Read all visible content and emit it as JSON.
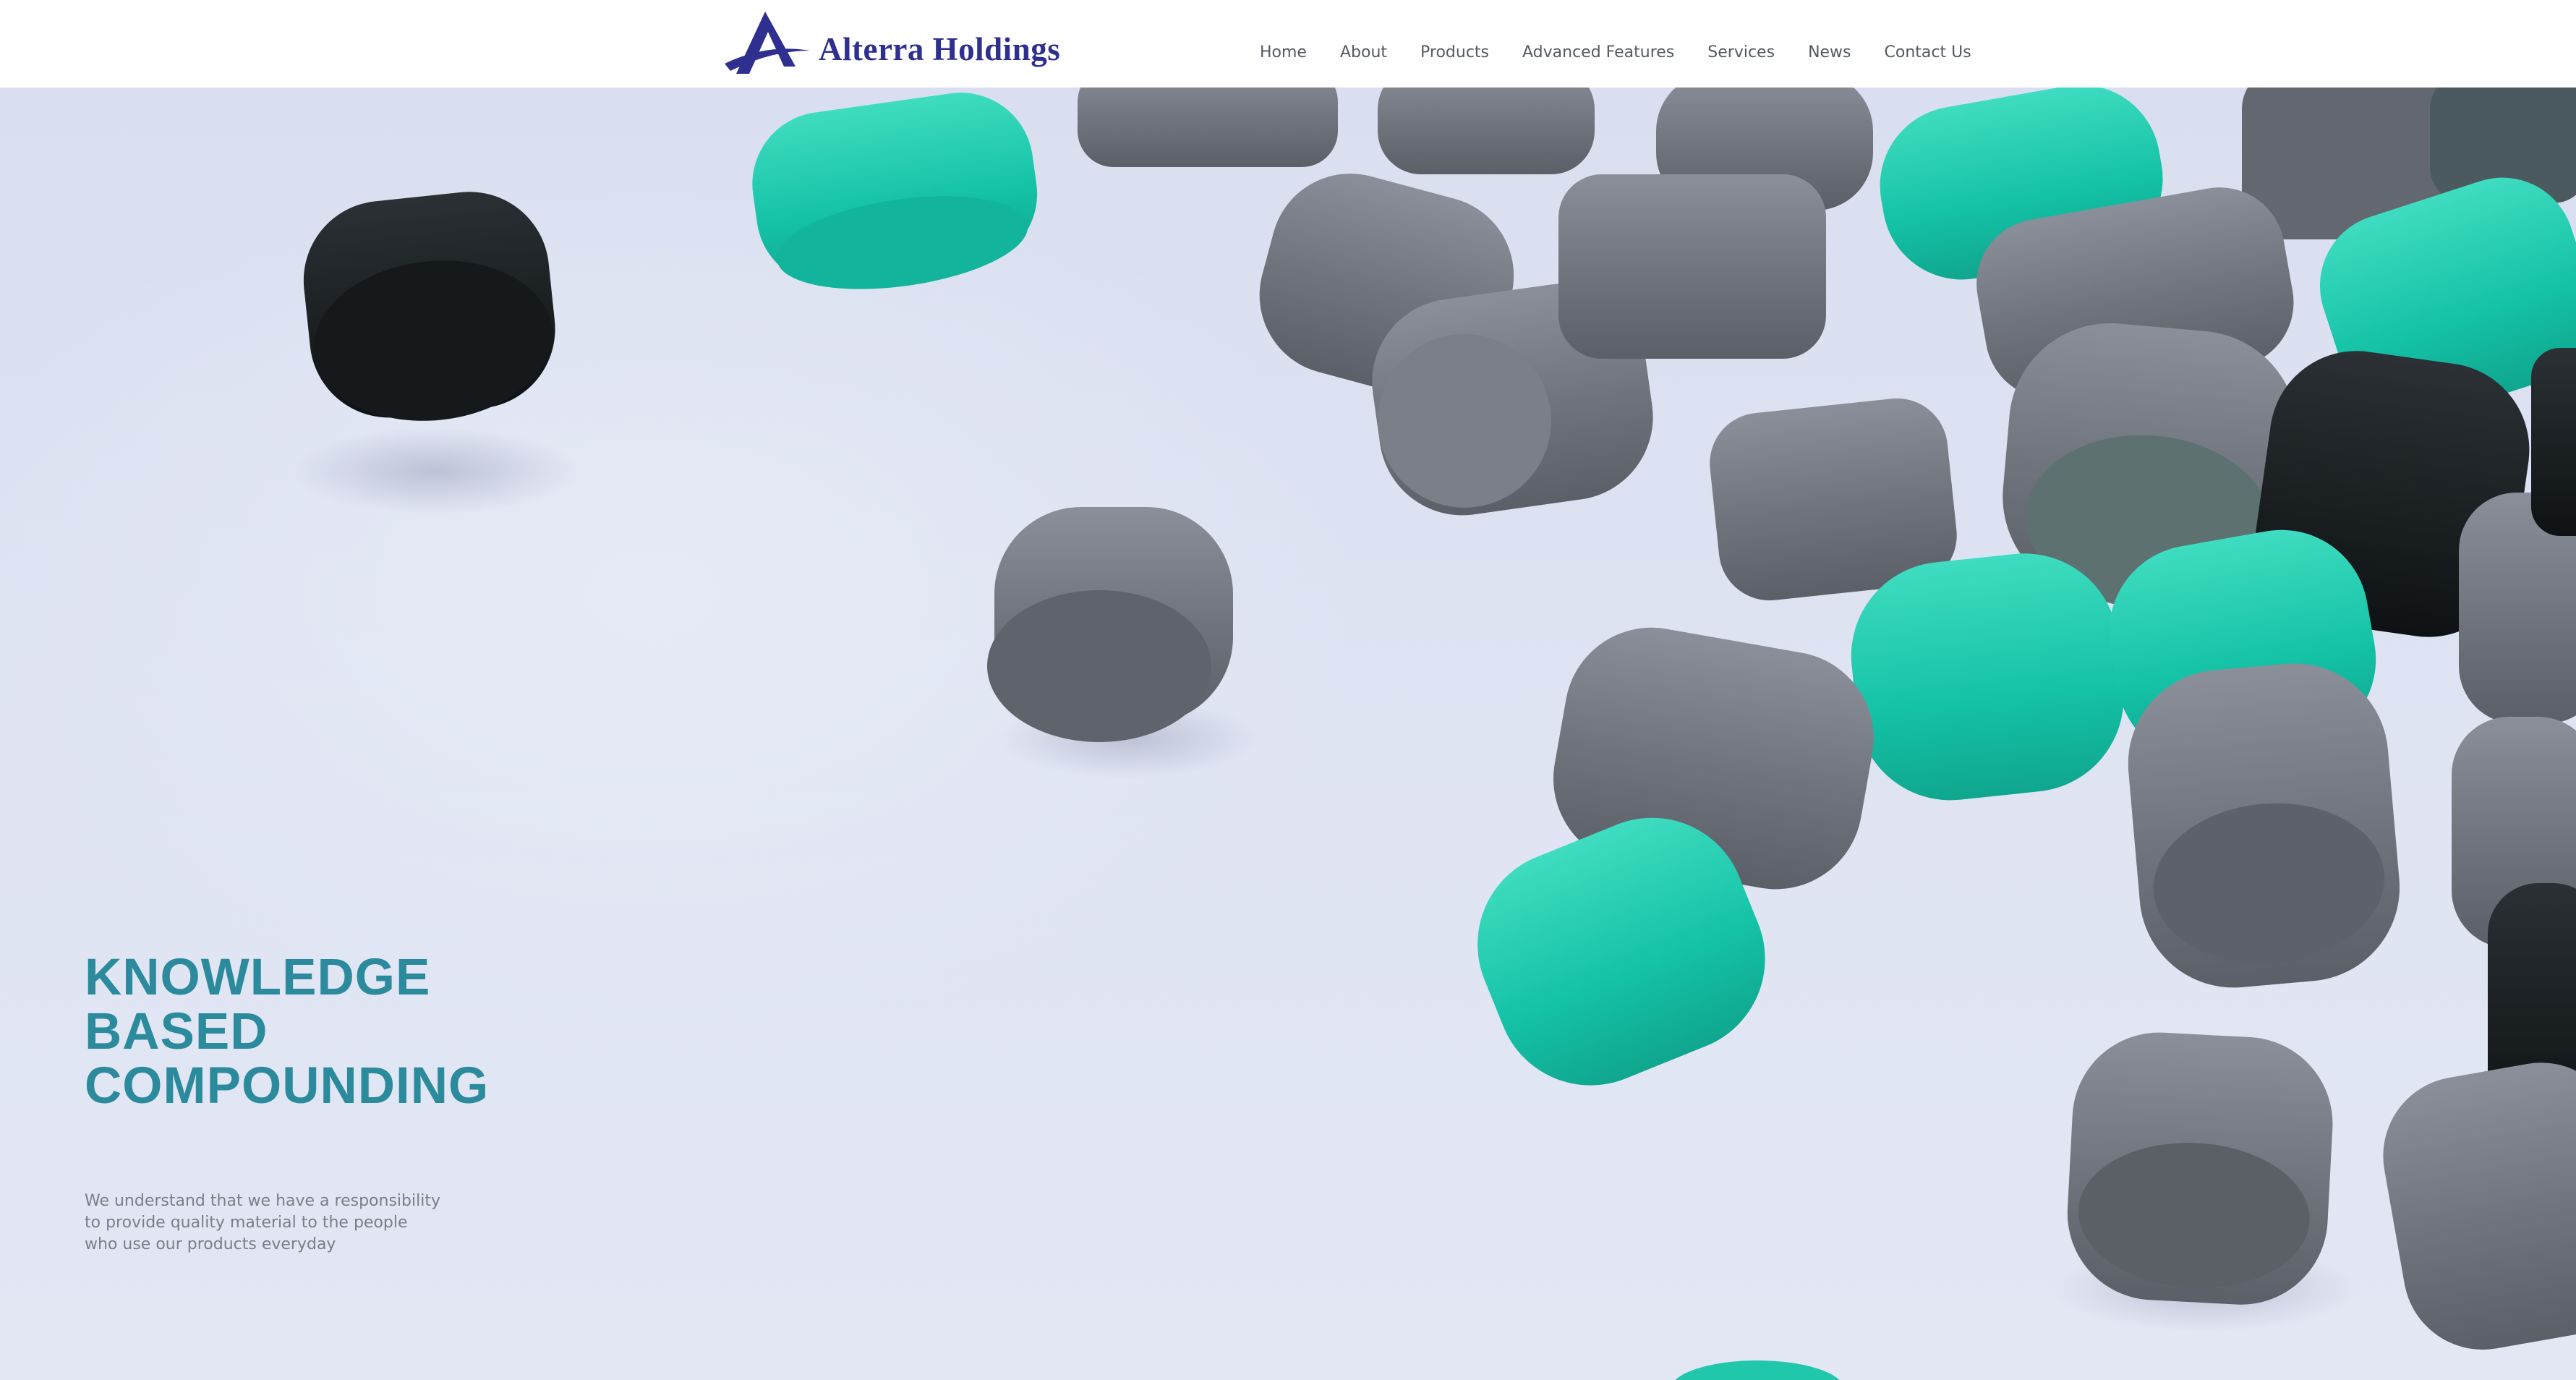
{
  "brand": {
    "name": "Alterra Holdings",
    "color": "#2e2f8f"
  },
  "nav": {
    "items": [
      {
        "label": "Home"
      },
      {
        "label": "About"
      },
      {
        "label": "Products"
      },
      {
        "label": "Advanced Features"
      },
      {
        "label": "Services"
      },
      {
        "label": "News"
      },
      {
        "label": "Contact Us"
      }
    ]
  },
  "hero": {
    "headline_lines": [
      "KNOWLEDGE",
      "BASED",
      "COMPOUNDING"
    ],
    "headline_color": "#2b8a9c",
    "description_lines": [
      "We understand that we have a responsibility",
      "to provide quality material to the people",
      "who use our products everyday"
    ],
    "background_image": "plastic-pellets-photo"
  }
}
